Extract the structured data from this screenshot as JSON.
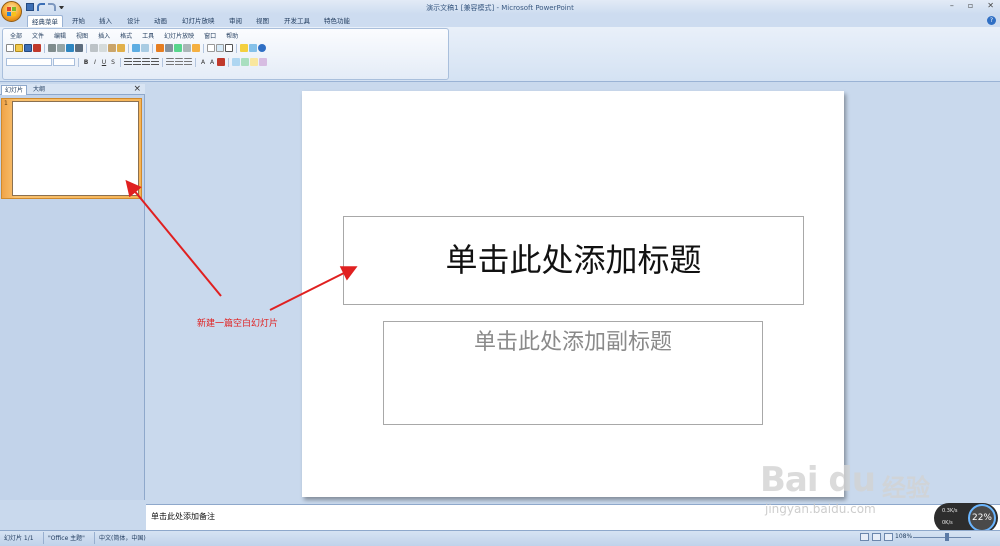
{
  "window": {
    "title": "演示文稿1 [兼容模式] - Microsoft PowerPoint",
    "minimize": "–",
    "restore": "▫",
    "close": "✕"
  },
  "tabs": [
    "经典菜单",
    "开始",
    "插入",
    "设计",
    "动画",
    "幻灯片放映",
    "审阅",
    "视图",
    "开发工具",
    "特色功能"
  ],
  "active_tab": "经典菜单",
  "menus": [
    "全部",
    "文件",
    "编辑",
    "视图",
    "插入",
    "格式",
    "工具",
    "幻灯片放映",
    "窗口",
    "帮助"
  ],
  "pane": {
    "tab_slides": "幻灯片",
    "tab_outline": "大纲",
    "close": "×",
    "slide_number": "1"
  },
  "slide": {
    "title_placeholder": "单击此处添加标题",
    "subtitle_placeholder": "单击此处添加副标题"
  },
  "notes": {
    "placeholder": "单击此处添加备注"
  },
  "annotation": {
    "label": "新建一篇空白幻灯片",
    "color": "#e02020"
  },
  "watermark": {
    "logo": "Bai du",
    "cn": "经验",
    "url": "jingyan.baidu.com"
  },
  "speed_widget": {
    "up": "0.3K/s",
    "down": "0K/s",
    "percent": "22%"
  },
  "status": {
    "slide": "幻灯片 1/1",
    "theme": "\"Office 主题\"",
    "language": "中文(简体，中国)",
    "zoom": "108%"
  },
  "icons": [
    "office-logo-icon",
    "save-icon",
    "undo-icon",
    "redo-icon",
    "help-icon",
    "close-icon"
  ],
  "colors": {
    "accent": "#f4a11f",
    "ribbon": "#d4e2f3",
    "selection": "#f7b557"
  }
}
